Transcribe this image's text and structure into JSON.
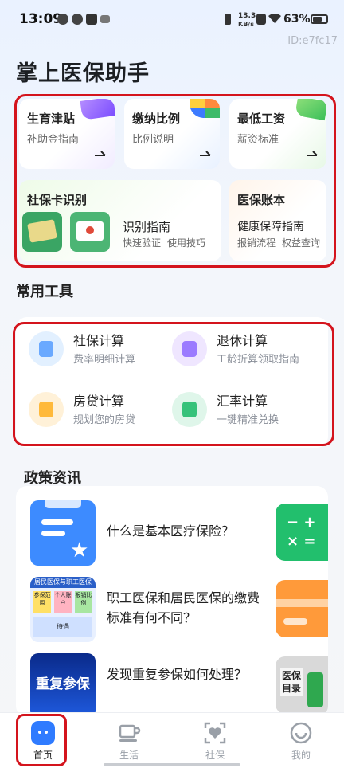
{
  "status_bar": {
    "time": "13:09",
    "net_speed_value": "13.3",
    "net_speed_unit": "KB/s",
    "battery": "63%"
  },
  "page": {
    "id_label": "ID:e7fc17",
    "title": "掌上医保助手"
  },
  "feature_cards": [
    {
      "title": "生育津贴",
      "subtitle": "补助金指南"
    },
    {
      "title": "缴纳比例",
      "subtitle": "比例说明"
    },
    {
      "title": "最低工资",
      "subtitle": "薪资标准"
    }
  ],
  "sicard_card": {
    "title": "社保卡识别",
    "guide_title": "识别指南",
    "tag1": "快速验证",
    "tag2": "使用技巧"
  },
  "account_card": {
    "title": "医保账本",
    "guide_title": "健康保障指南",
    "tag1": "报销流程",
    "tag2": "权益查询"
  },
  "tools_section": {
    "title": "常用工具",
    "items": [
      {
        "name": "社保计算",
        "desc": "费率明细计算"
      },
      {
        "name": "退休计算",
        "desc": "工龄折算领取指南"
      },
      {
        "name": "房贷计算",
        "desc": "规划您的房贷"
      },
      {
        "name": "汇率计算",
        "desc": "一键精准兑换"
      }
    ]
  },
  "news_section": {
    "title": "政策资讯",
    "items": [
      {
        "title": "什么是基本医疗保险？"
      },
      {
        "title": "职工医保和居民医保的缴费标准有何不同？"
      },
      {
        "title": "发现重复参保如何处理？"
      }
    ],
    "thumb2_texts": [
      "居民医保与职工医保",
      "参保范围",
      "个人账户",
      "报销比例",
      "待遇"
    ],
    "thumb3_text": "重复参保",
    "side3_text": "医保目录"
  },
  "tab_bar": {
    "tabs": [
      {
        "label": "首页"
      },
      {
        "label": "生活"
      },
      {
        "label": "社保"
      },
      {
        "label": "我的"
      }
    ]
  },
  "colors": {
    "accent": "#2f7bff",
    "highlight_box": "#d4141d"
  }
}
